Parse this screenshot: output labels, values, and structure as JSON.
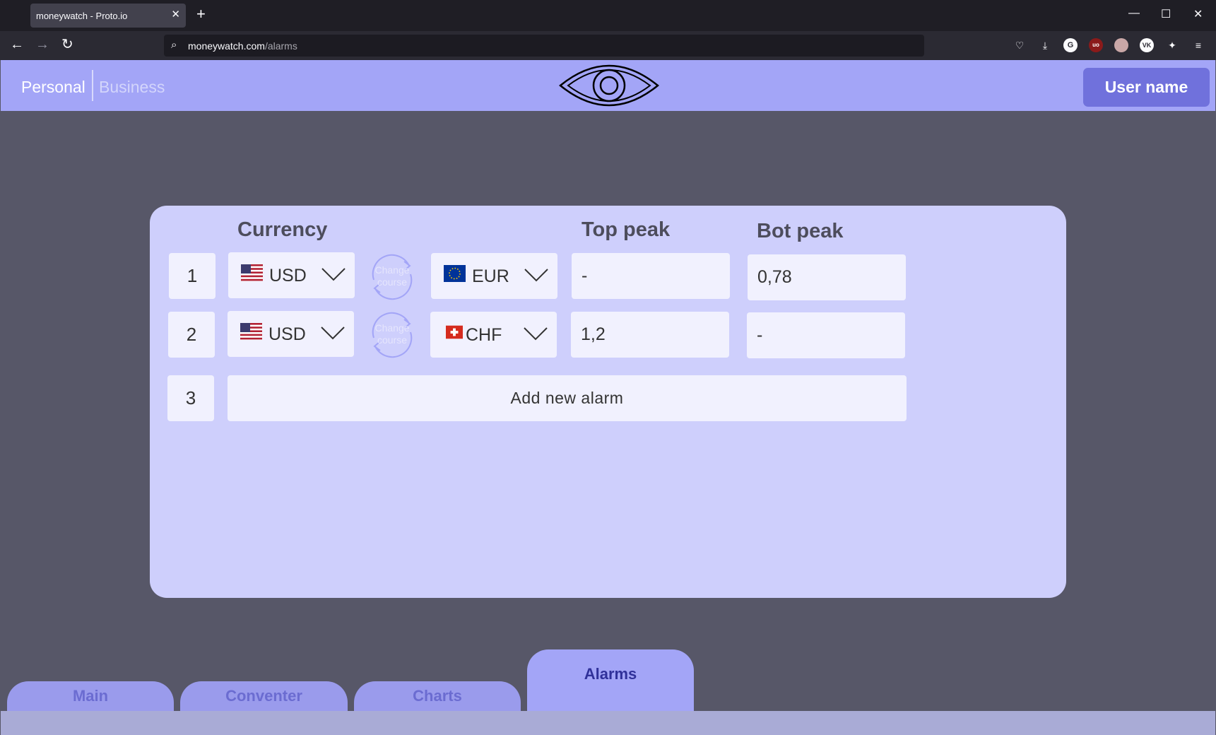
{
  "browser": {
    "tab_title": "moneywatch - Proto.io",
    "url_host": "moneywatch.com",
    "url_path": "/alarms",
    "icons": [
      "back-arrow-icon",
      "forward-arrow-icon",
      "reload-icon",
      "search-icon",
      "pocket-icon",
      "download-icon",
      "grammarly-icon",
      "ublock-icon",
      "extension-icon",
      "vk-icon",
      "extension-icon",
      "menu-icon"
    ]
  },
  "header": {
    "nav_personal": "Personal",
    "nav_business": "Business",
    "logo": "eye-icon",
    "user_button": "User name"
  },
  "table": {
    "col_currency": "Currency",
    "col_top_peak": "Top peak",
    "col_bot_peak": "Bot peak",
    "swap_label": "Change course",
    "rows": [
      {
        "num": "1",
        "from": "USD",
        "from_flag": "us-flag-icon",
        "to": "EUR",
        "to_flag": "eu-flag-icon",
        "top_peak": "-",
        "bot_peak": "0,78"
      },
      {
        "num": "2",
        "from": "USD",
        "from_flag": "us-flag-icon",
        "to": "CHF",
        "to_flag": "ch-flag-icon",
        "top_peak": "1,2",
        "bot_peak": "-"
      }
    ],
    "new_row_num": "3",
    "add_button": "Add new alarm"
  },
  "bottom_tabs": [
    {
      "label": "Main",
      "active": false
    },
    {
      "label": "Conventer",
      "active": false
    },
    {
      "label": "Charts",
      "active": false
    },
    {
      "label": "Alarms",
      "active": true
    }
  ],
  "colors": {
    "page_bg": "#575768",
    "header_bg": "#a3a5f7",
    "panel_bg": "#cecffc",
    "user_button_bg": "#7071dc",
    "cell_bg": "#f1f1fe"
  }
}
